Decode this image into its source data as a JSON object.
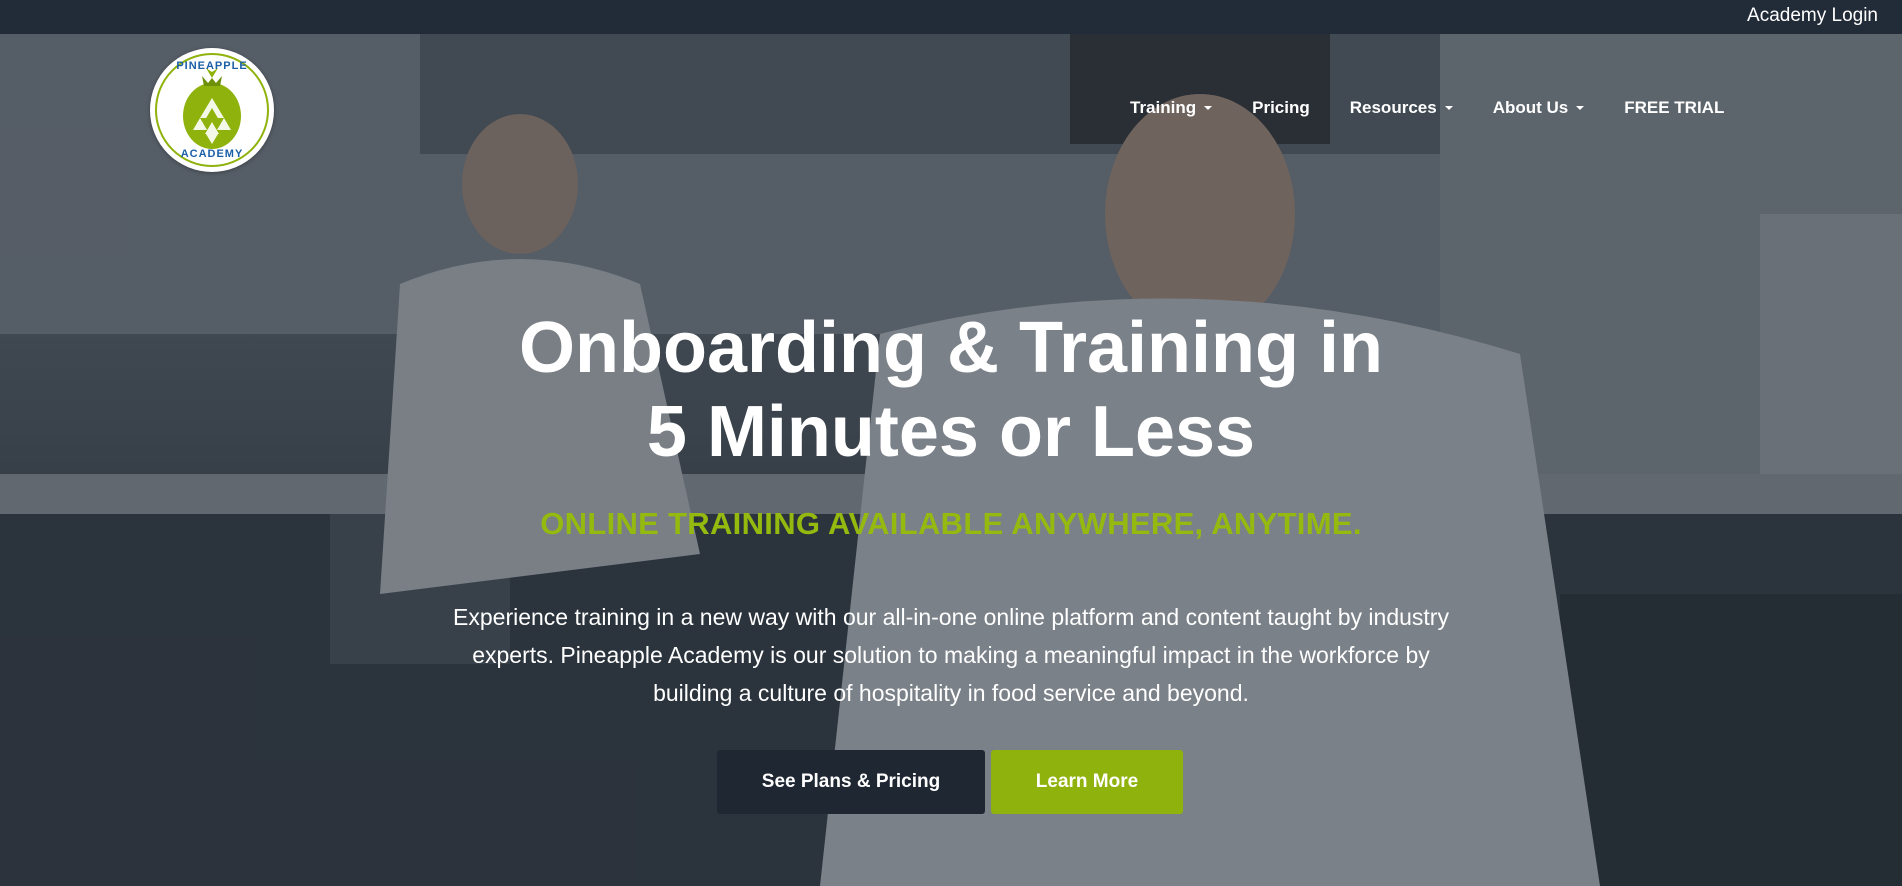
{
  "topbar": {
    "login_label": "Academy Login"
  },
  "logo": {
    "top_text": "PINEAPPLE",
    "bottom_text": "ACADEMY",
    "icon": "pineapple-icon",
    "brand_green": "#8fb30c",
    "brand_blue": "#1b5fa8"
  },
  "nav": {
    "items": [
      {
        "label": "Training",
        "has_dropdown": true
      },
      {
        "label": "Pricing",
        "has_dropdown": false
      },
      {
        "label": "Resources",
        "has_dropdown": true
      },
      {
        "label": "About Us",
        "has_dropdown": true
      },
      {
        "label": "FREE TRIAL",
        "has_dropdown": false
      }
    ]
  },
  "hero": {
    "headline_line1": "Onboarding & Training in",
    "headline_line2": "5 Minutes or Less",
    "tagline": "ONLINE TRAINING AVAILABLE ANYWHERE, ANYTIME.",
    "description": "Experience training in a new way with our all-in-one online platform and content taught by industry experts. Pineapple Academy is our solution to making a meaningful impact in the workforce by building a culture of hospitality in food service and beyond.",
    "primary_button": "See Plans & Pricing",
    "secondary_button": "Learn More",
    "accent_color": "#94b90f",
    "dark_color": "#1f2733"
  }
}
